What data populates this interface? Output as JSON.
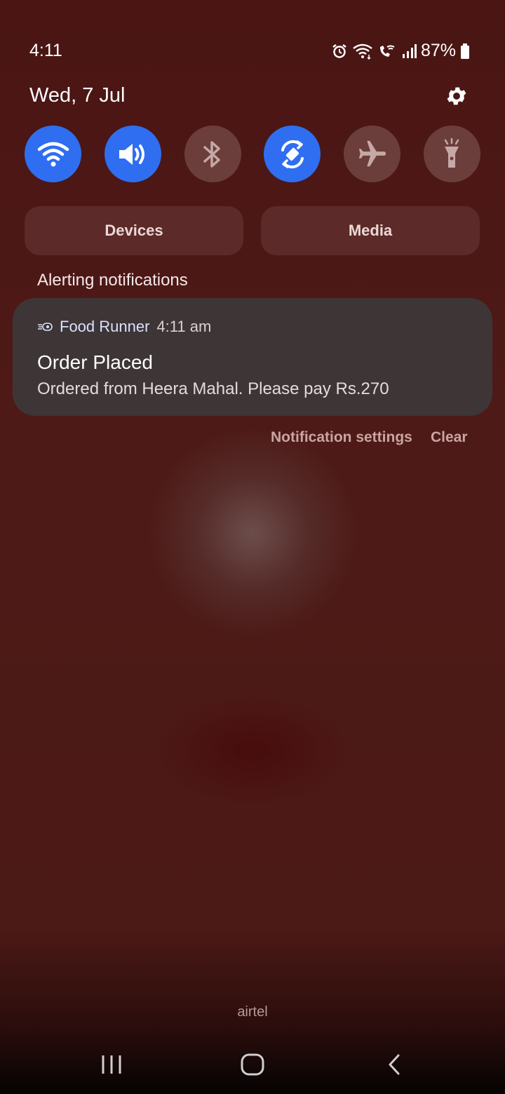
{
  "status_bar": {
    "time": "4:11",
    "battery": "87%",
    "icons": [
      "alarm-icon",
      "wifi-icon",
      "wifi-calling-icon",
      "signal-icon",
      "battery-icon"
    ]
  },
  "panel": {
    "date": "Wed, 7 Jul",
    "settings_icon": "gear-icon"
  },
  "quick_tiles": [
    {
      "icon": "wifi-icon",
      "state": "on"
    },
    {
      "icon": "sound-icon",
      "state": "on"
    },
    {
      "icon": "bluetooth-icon",
      "state": "off"
    },
    {
      "icon": "auto-rotate-icon",
      "state": "on"
    },
    {
      "icon": "airplane-icon",
      "state": "off"
    },
    {
      "icon": "flashlight-icon",
      "state": "off"
    }
  ],
  "buttons": {
    "devices": "Devices",
    "media": "Media"
  },
  "section": {
    "title": "Alerting notifications"
  },
  "notification": {
    "app": "Food Runner",
    "time": "4:11 am",
    "title": "Order Placed",
    "body": "Ordered from Heera Mahal. Please pay Rs.270"
  },
  "actions": {
    "settings": "Notification settings",
    "clear": "Clear"
  },
  "carrier": "airtel",
  "colors": {
    "accent": "#2f6ef0",
    "tile_off": "#6b3e3b",
    "background": "#4a1513",
    "card": "#3d3536"
  }
}
